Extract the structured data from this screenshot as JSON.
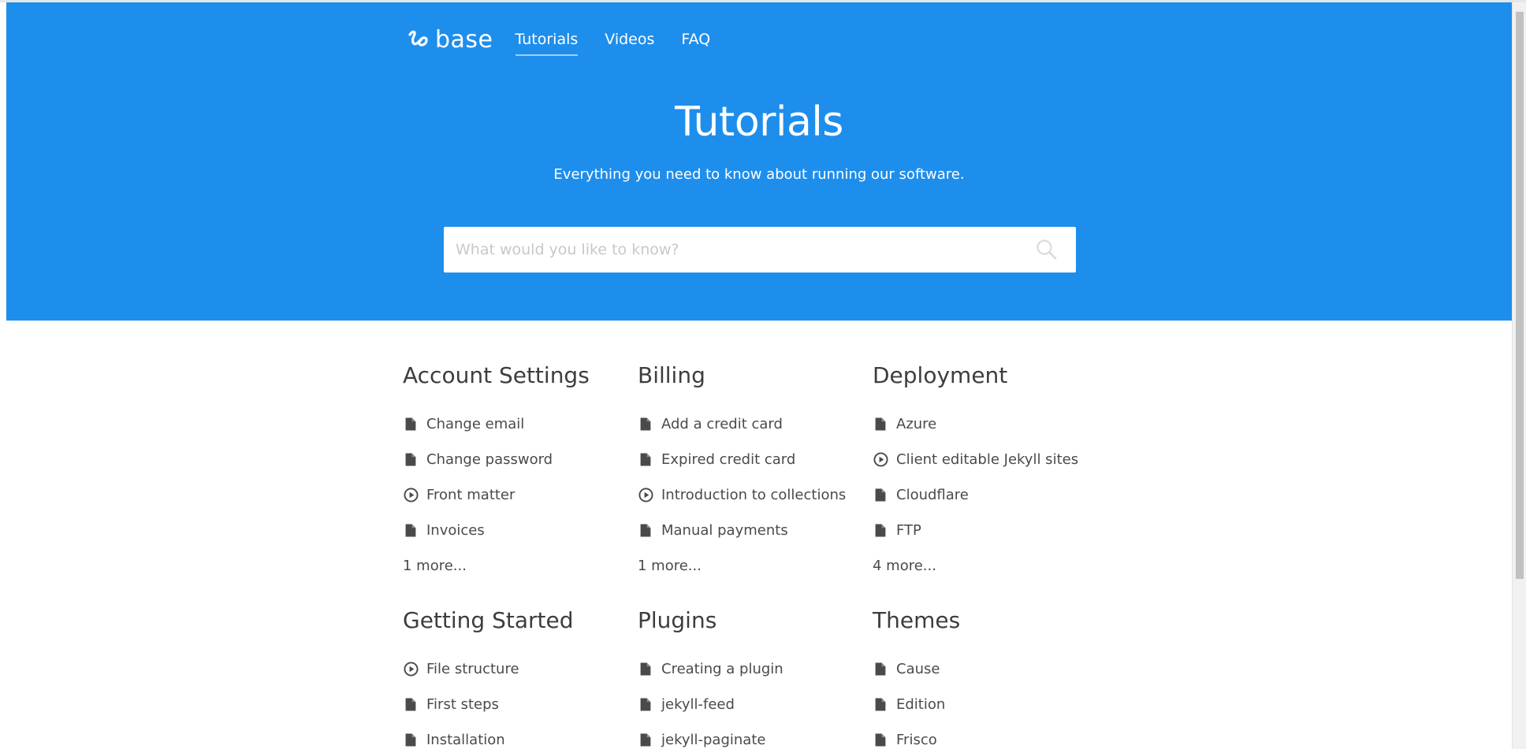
{
  "nav": {
    "logo_text": "base",
    "links": [
      "Tutorials",
      "Videos",
      "FAQ"
    ],
    "active": "Tutorials"
  },
  "hero": {
    "title": "Tutorials",
    "subtitle": "Everything you need to know about running our software.",
    "search_placeholder": "What would you like to know?"
  },
  "colors": {
    "hero_bg": "#1e8eed",
    "text": "#444444"
  },
  "categories": [
    {
      "title": "Account Settings",
      "items": [
        {
          "label": "Change email",
          "icon": "document-icon"
        },
        {
          "label": "Change password",
          "icon": "document-icon"
        },
        {
          "label": "Front matter",
          "icon": "video-icon"
        },
        {
          "label": "Invoices",
          "icon": "document-icon"
        }
      ],
      "more": "1 more..."
    },
    {
      "title": "Billing",
      "items": [
        {
          "label": "Add a credit card",
          "icon": "document-icon"
        },
        {
          "label": "Expired credit card",
          "icon": "document-icon"
        },
        {
          "label": "Introduction to collections",
          "icon": "video-icon"
        },
        {
          "label": "Manual payments",
          "icon": "document-icon"
        }
      ],
      "more": "1 more..."
    },
    {
      "title": "Deployment",
      "items": [
        {
          "label": "Azure",
          "icon": "document-icon"
        },
        {
          "label": "Client editable Jekyll sites",
          "icon": "video-icon"
        },
        {
          "label": "Cloudflare",
          "icon": "document-icon"
        },
        {
          "label": "FTP",
          "icon": "document-icon"
        }
      ],
      "more": "4 more..."
    },
    {
      "title": "Getting Started",
      "items": [
        {
          "label": "File structure",
          "icon": "video-icon"
        },
        {
          "label": "First steps",
          "icon": "document-icon"
        },
        {
          "label": "Installation",
          "icon": "document-icon"
        }
      ],
      "more": ""
    },
    {
      "title": "Plugins",
      "items": [
        {
          "label": "Creating a plugin",
          "icon": "document-icon"
        },
        {
          "label": "jekyll-feed",
          "icon": "document-icon"
        },
        {
          "label": "jekyll-paginate",
          "icon": "document-icon"
        }
      ],
      "more": ""
    },
    {
      "title": "Themes",
      "items": [
        {
          "label": "Cause",
          "icon": "document-icon"
        },
        {
          "label": "Edition",
          "icon": "document-icon"
        },
        {
          "label": "Frisco",
          "icon": "document-icon"
        }
      ],
      "more": ""
    }
  ]
}
